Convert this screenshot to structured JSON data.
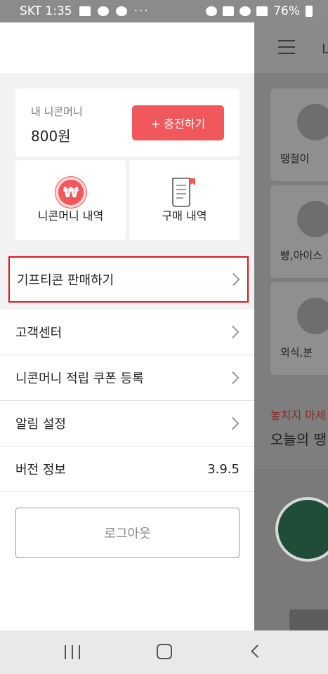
{
  "status_bar": {
    "carrier_time": "SKT 1:35",
    "more": "···",
    "battery": "76%"
  },
  "background_app": {
    "title": "나",
    "categories": [
      "땡철이",
      "빵,아이스",
      "외식,분"
    ],
    "promo_text": "놓치지 마세",
    "section_title": "오늘의 땡"
  },
  "drawer": {
    "money": {
      "label": "내 니콘머니",
      "value": "800원",
      "charge_button": "+ 충전하기"
    },
    "tiles": [
      {
        "label": "니콘머니 내역",
        "icon": "won-icon"
      },
      {
        "label": "구매 내역",
        "icon": "receipt-icon"
      }
    ],
    "sell": {
      "label": "기프티콘 판매하기"
    },
    "menu": [
      {
        "label": "고객센터"
      },
      {
        "label": "니콘머니 적립 쿠폰 등록"
      },
      {
        "label": "알림 설정"
      }
    ],
    "version": {
      "label": "버전 정보",
      "value": "3.9.5"
    },
    "logout": "로그아웃"
  },
  "nav_bar": {
    "icons": [
      "recent-apps-icon",
      "home-icon",
      "back-icon"
    ]
  },
  "colors": {
    "accent": "#f1585b",
    "highlight_border": "#d71920"
  }
}
